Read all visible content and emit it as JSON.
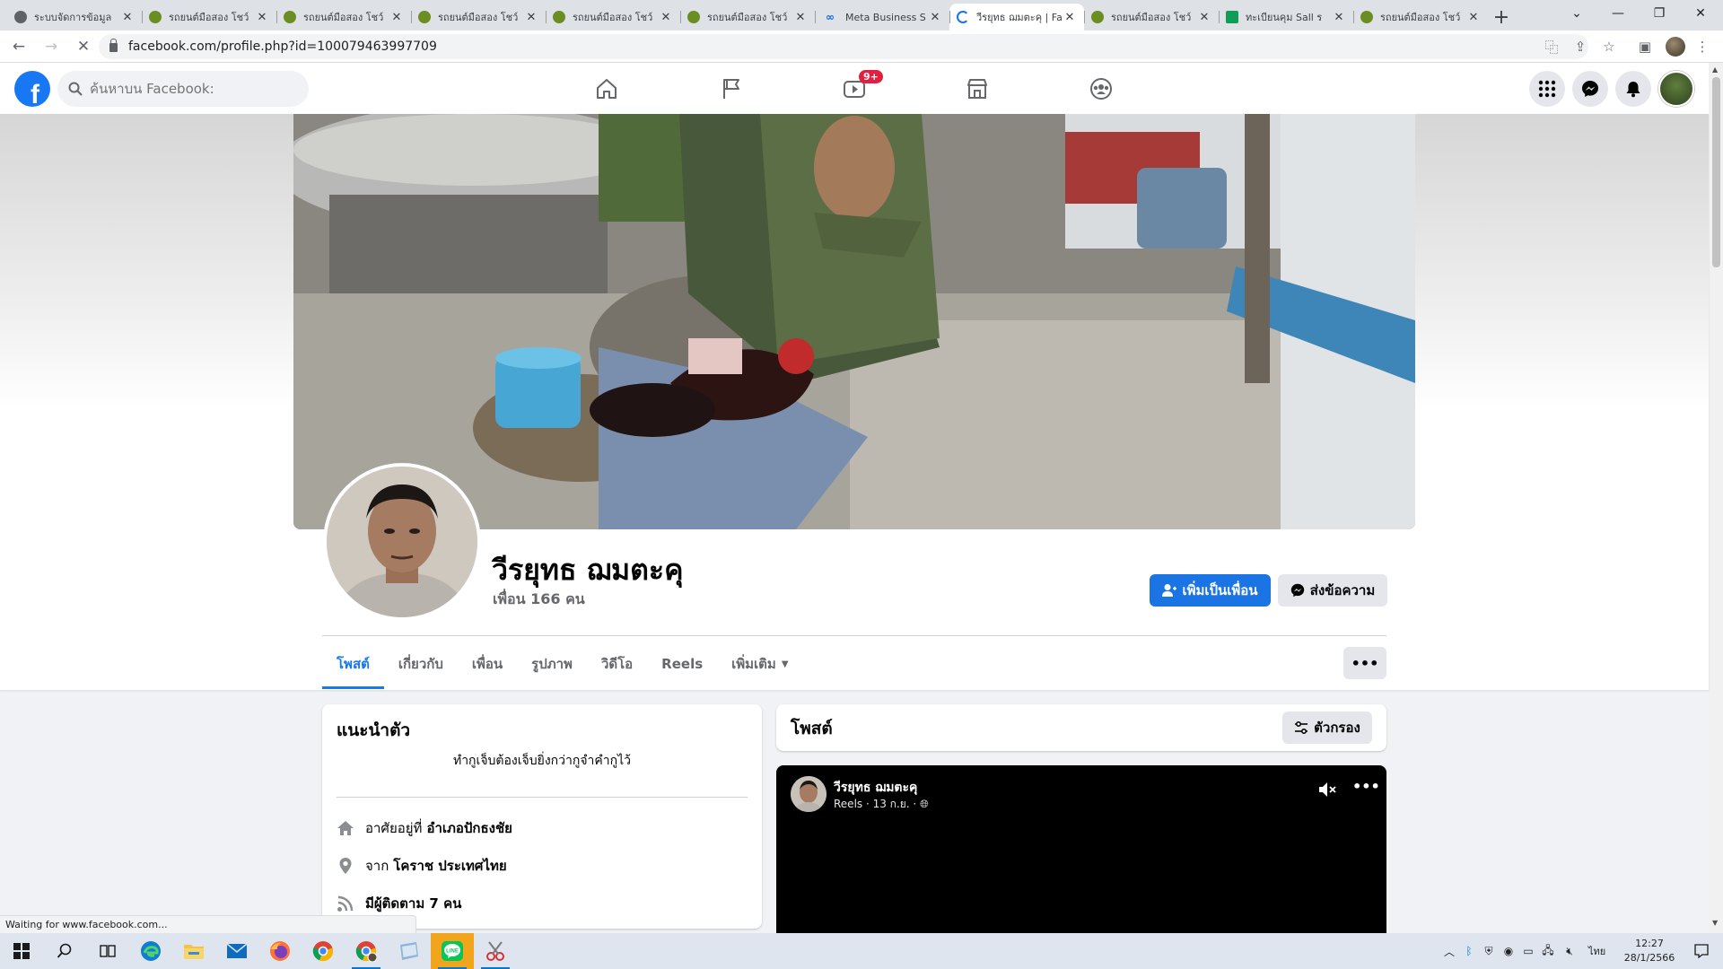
{
  "browser": {
    "tabs": [
      {
        "title": "ระบบจัดการข้อมูล",
        "favicon": "globe-icon",
        "active": false
      },
      {
        "title": "รถยนต์มือสอง โชว์",
        "favicon": "rooster-icon",
        "active": false
      },
      {
        "title": "รถยนต์มือสอง โชว์",
        "favicon": "rooster-icon",
        "active": false
      },
      {
        "title": "รถยนต์มือสอง โชว์",
        "favicon": "rooster-icon",
        "active": false
      },
      {
        "title": "รถยนต์มือสอง โชว์",
        "favicon": "rooster-icon",
        "active": false
      },
      {
        "title": "รถยนต์มือสอง โชว์",
        "favicon": "rooster-icon",
        "active": false
      },
      {
        "title": "Meta Business S",
        "favicon": "meta-icon",
        "active": false
      },
      {
        "title": "วีรยุทธ ฌมตะคุ | Fa",
        "favicon": "loading-icon",
        "active": true
      },
      {
        "title": "รถยนต์มือสอง โชว์",
        "favicon": "rooster-icon",
        "active": false
      },
      {
        "title": "ทะเบียนคุม Sall ร",
        "favicon": "sheets-icon",
        "active": false
      },
      {
        "title": "รถยนต์มือสอง โชว์",
        "favicon": "rooster-icon",
        "active": false
      }
    ],
    "url": "facebook.com/profile.php?id=100079463997709",
    "status_text": "Waiting for www.facebook.com..."
  },
  "facebook": {
    "search_placeholder": "ค้นหาบน Facebook:",
    "video_badge": "9+"
  },
  "profile": {
    "name": "วีรยุทธ ฌมตะคุ",
    "friends": "เพื่อน 166 คน",
    "add_friend_label": "เพิ่มเป็นเพื่อน",
    "message_label": "ส่งข้อความ",
    "tabs": [
      {
        "label": "โพสต์",
        "active": true
      },
      {
        "label": "เกี่ยวกับ",
        "active": false
      },
      {
        "label": "เพื่อน",
        "active": false
      },
      {
        "label": "รูปภาพ",
        "active": false
      },
      {
        "label": "วิดีโอ",
        "active": false
      },
      {
        "label": "Reels",
        "active": false
      },
      {
        "label": "เพิ่มเติม",
        "active": false
      }
    ]
  },
  "intro": {
    "title": "แนะนำตัว",
    "bio": "ทำกูเจ็บต้องเจ็บยิ่งกว่ากูจำคำกูไว้",
    "lives_prefix": "อาศัยอยู่ที่",
    "lives_value": "อำเภอปักธงชัย",
    "from_prefix": "จาก",
    "from_value": "โคราช ประเทศไทย",
    "followers": "มีผู้ติดตาม 7 คน"
  },
  "posts": {
    "title": "โพสต์",
    "filter_label": "ตัวกรอง",
    "reel": {
      "author": "วีรยุทธ ฌมตะคุ",
      "meta": "Reels · 13 ก.ย. ·"
    }
  },
  "taskbar": {
    "lang": "ไทย",
    "time": "12:27",
    "date": "28/1/2566"
  }
}
